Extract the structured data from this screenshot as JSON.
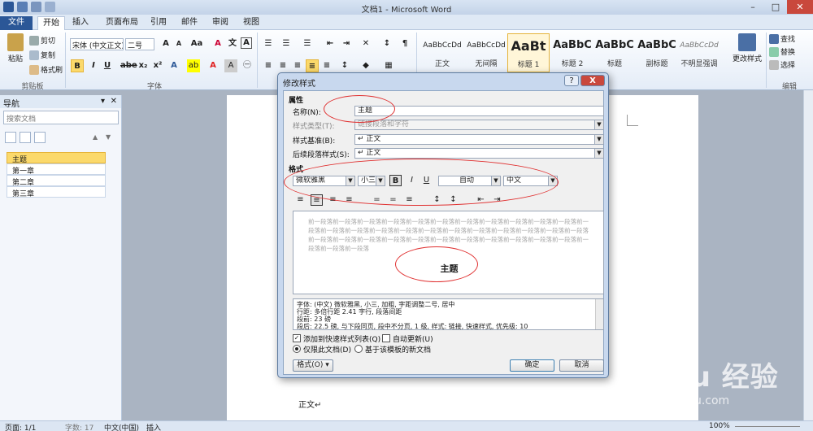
{
  "window": {
    "title": "文档1 - Microsoft Word"
  },
  "tabs": [
    "文件",
    "开始",
    "插入",
    "页面布局",
    "引用",
    "邮件",
    "审阅",
    "视图"
  ],
  "ribbon": {
    "clipboard": {
      "paste": "粘贴",
      "cut": "剪切",
      "copy": "复制",
      "painter": "格式刷",
      "label": "剪贴板"
    },
    "font": {
      "name": "宋体 (中文正文)",
      "size": "二号",
      "label": "字体"
    },
    "paragraph": {
      "label": "段落"
    },
    "styles": [
      {
        "sample": "AaBbCcDd",
        "label": "正文"
      },
      {
        "sample": "AaBbCcDd",
        "label": "无间隔"
      },
      {
        "sample": "AaBt",
        "label": "标题 1"
      },
      {
        "sample": "AaBbC",
        "label": "标题 2"
      },
      {
        "sample": "AaBbC",
        "label": "标题"
      },
      {
        "sample": "AaBbC",
        "label": "副标题"
      },
      {
        "sample": "AaBbCcDd",
        "label": "不明显强调"
      }
    ],
    "change_styles": "更改样式",
    "editing": {
      "find": "查找",
      "replace": "替换",
      "select": "选择",
      "label": "编辑"
    }
  },
  "nav": {
    "title": "导航",
    "search_placeholder": "搜索文档",
    "items": [
      "主题",
      "第一章",
      "第二章",
      "第三章"
    ]
  },
  "document": {
    "body_text": "正文↵"
  },
  "status": {
    "page": "页面: 1/1",
    "words": "字数: 17",
    "lang": "中文(中国)",
    "mode": "插入",
    "zoom": "100%"
  },
  "dialog": {
    "title": "修改样式",
    "help": "?",
    "close": "X",
    "props_header": "属性",
    "name_label": "名称(N):",
    "name_value": "主题",
    "type_label": "样式类型(T):",
    "type_value": "链接段落和字符",
    "based_label": "样式基准(B):",
    "based_value": "↵ 正文",
    "next_label": "后续段落样式(S):",
    "next_value": "↵ 正文",
    "format_header": "格式",
    "font_value": "微软雅黑",
    "size_value": "小三",
    "bold": "B",
    "italic": "I",
    "underline": "U",
    "color_value": "自动",
    "script_value": "中文",
    "preview_gray": "前一段落前一段落前一段落前一段落前一段落前一段落前一段落前一段落前一段落前一段落前一段落前一段落前一段落前一段落前一段落前一段落前一段落前一段落前一段落前一段落前一段落前一段落前一段落前一段落前一段落前一段落前一段落前一段落前一段落前一段落前一段落前一段落前一段落前一段落前一段落前一段落前一段落",
    "preview_title": "主题",
    "desc_line1": "字体: (中文) 微软雅黑, 小三, 加粗, 字距调整二号, 居中",
    "desc_line2": "    行距: 多倍行距 2.41 字行, 段落间距",
    "desc_line3": "    段前: 23 磅",
    "desc_line4": "    段后: 22.5 磅, 与下段同页, 段中不分页, 1 级, 样式: 链接, 快速样式, 优先级: 10",
    "add_quick": "添加到快速样式列表(Q)",
    "auto_update": "自动更新(U)",
    "only_doc": "仅限此文档(D)",
    "new_docs": "基于该模板的新文档",
    "format_btn": "格式(O) ▾",
    "ok": "确定",
    "cancel": "取消"
  },
  "watermark": {
    "brand": "Bai du 经验",
    "url": "jingyan.baidu.com"
  }
}
